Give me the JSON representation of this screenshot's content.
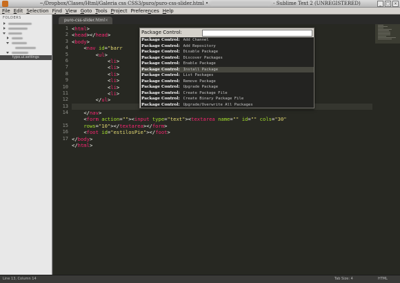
{
  "window": {
    "title_prefix": "~/Dropbox/Clases/Html/Galeria css CSS3/puro/puro-css-slider.html •",
    "title_suffix": "- Sublime Text 2 (UNREGISTERED)",
    "buttons": [
      "_",
      "□",
      "×"
    ]
  },
  "menu": [
    {
      "u": "F",
      "rest": "ile"
    },
    {
      "u": "E",
      "rest": "dit"
    },
    {
      "u": "S",
      "rest": "election"
    },
    {
      "pre": "F",
      "u": "i",
      "rest": "nd"
    },
    {
      "u": "V",
      "rest": "iew"
    },
    {
      "u": "G",
      "rest": "oto"
    },
    {
      "u": "T",
      "rest": "ools"
    },
    {
      "u": "P",
      "rest": "roject"
    },
    {
      "pre": "Prefere",
      "u": "n",
      "rest": "ces"
    },
    {
      "u": "H",
      "rest": "elp"
    }
  ],
  "sidebar": {
    "header": "FOLDERS",
    "selected_item": "typo.ui.settings"
  },
  "tab": {
    "label": "puro-css-slider.html",
    "close": "×"
  },
  "editor": {
    "line_numbers": [
      "1",
      "2",
      "3",
      "4",
      "5",
      "6",
      "7",
      "8",
      "9",
      "10",
      "11",
      "12",
      "13",
      "14",
      "",
      "15",
      "16",
      "17"
    ],
    "highlighted_line": 13
  },
  "palette": {
    "prompt": "Package Control:",
    "input_value": "",
    "prefix": "Package Control:",
    "items": [
      "Add Channel",
      "Add Repository",
      "Disable Package",
      "Discover Packages",
      "Enable Package",
      "Install Package",
      "List Packages",
      "Remove Package",
      "Upgrade Package",
      "Create Package File",
      "Create Binary Package File",
      "Upgrade/Overwrite All Packages"
    ],
    "selected_index": 5
  },
  "status": {
    "position": "Line 13, Column 14",
    "tab_size": "Tab Size: 4",
    "syntax": "HTML"
  }
}
